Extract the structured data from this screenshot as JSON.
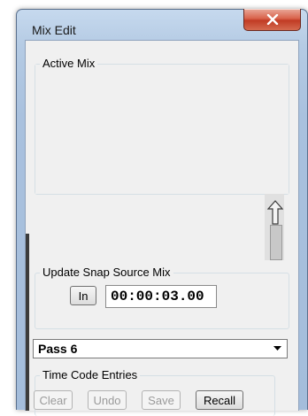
{
  "window": {
    "title": "Mix Edit",
    "close_icon": "close-x-icon"
  },
  "active_mix": {
    "label": "Active Mix"
  },
  "scroll": {
    "arrow_icon": "up-arrow-icon"
  },
  "snap_source": {
    "label": "Update Snap Source Mix",
    "in_button": "In",
    "timecode": "00:00:03.00"
  },
  "pass_select": {
    "value": "Pass 6",
    "caret_icon": "chevron-down-icon"
  },
  "time_code_entries": {
    "label": "Time Code Entries",
    "buttons": {
      "clear": "Clear",
      "undo": "Undo",
      "save": "Save",
      "recall": "Recall"
    }
  }
}
